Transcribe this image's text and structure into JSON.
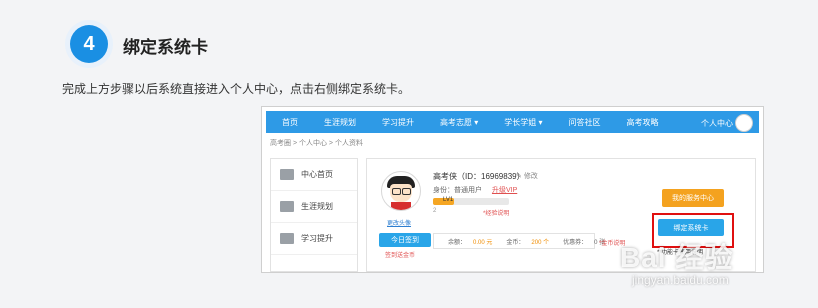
{
  "step": {
    "number": "4",
    "title": "绑定系统卡"
  },
  "instruction": "完成上方步骤以后系统直接进入个人中心，点击右侧绑定系统卡。",
  "screenshot": {
    "nav": {
      "items": [
        "首页",
        "生涯规划",
        "学习提升",
        "高考志愿 ▾",
        "学长学姐 ▾",
        "问答社区",
        "高考攻略"
      ],
      "user_label": "个人中心"
    },
    "breadcrumb": "高考圈 > 个人中心 > 个人资料",
    "sidebar": [
      {
        "label": "中心首页",
        "icon": "bank-icon"
      },
      {
        "label": "生涯规划",
        "icon": "grid-icon"
      },
      {
        "label": "学习提升",
        "icon": "chart-icon"
      }
    ],
    "profile": {
      "name": "高考侠（ID：16969839）",
      "edit": "修改",
      "identity_label": "身份：",
      "identity_value": "普通用户",
      "upgrade_link": "升级VIP",
      "level": "LV1",
      "level_progress": 0.28,
      "level_value": "2",
      "level_rule": "*经验说明",
      "change_avatar": "更改头像",
      "checkin_button": "今日签到",
      "checkin_gift": "签到送金币",
      "balance": "余额：",
      "balance_value": "0.00 元",
      "coins": "金币：",
      "coins_value": "200 个",
      "coupons": "优惠券：",
      "coupons_value": "0 张",
      "coin_desc": "*金币说明",
      "service_button": "我的服务中心",
      "bind_button": "绑定系统卡",
      "func_desc": "* 功能卡使用说明"
    }
  },
  "watermark": {
    "text": "Bai 经验",
    "url": "jingyan.baidu.com"
  }
}
